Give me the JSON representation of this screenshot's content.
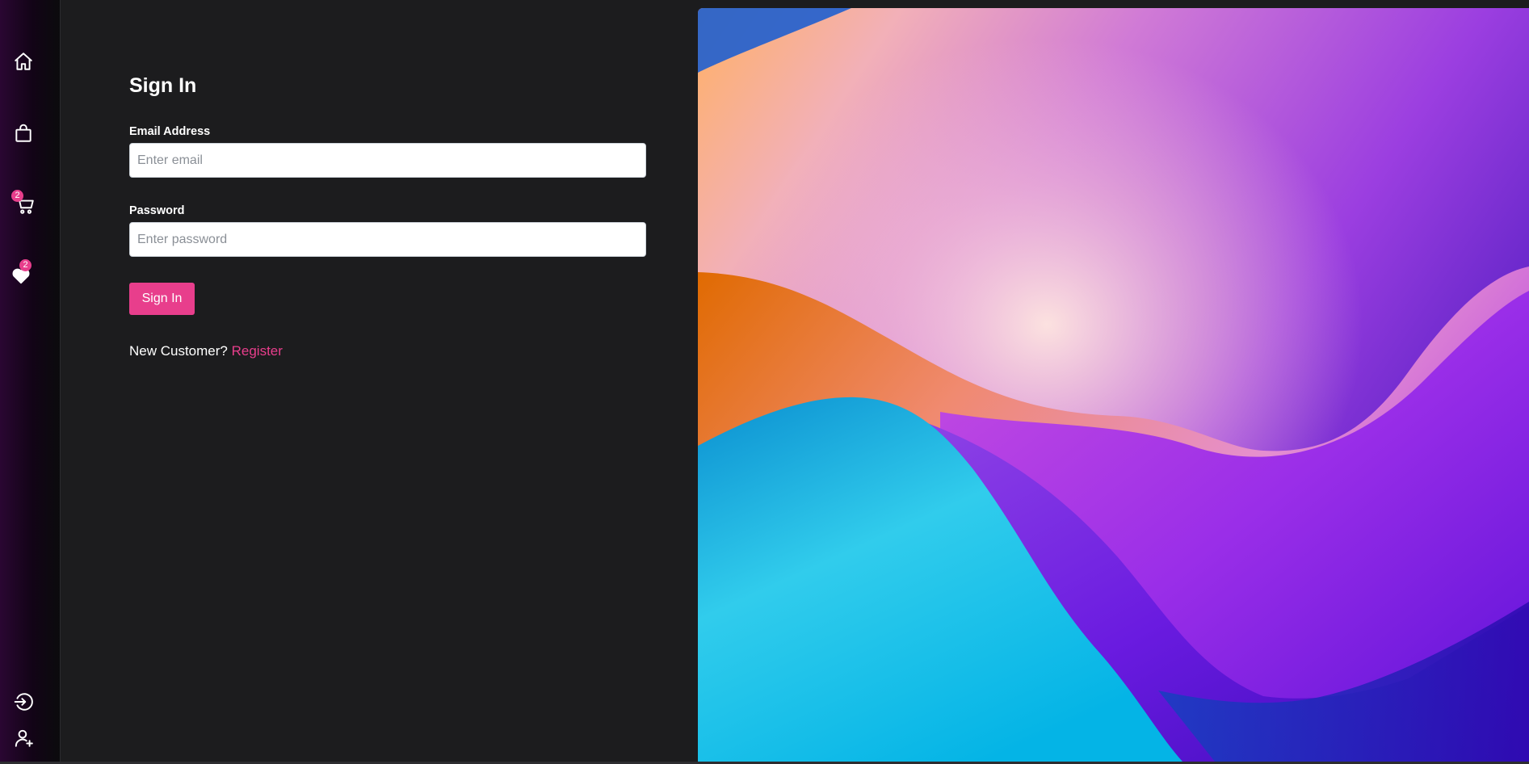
{
  "sidebar": {
    "items": [
      {
        "name": "home",
        "icon": "home-icon"
      },
      {
        "name": "shop",
        "icon": "shopping-bag-icon"
      },
      {
        "name": "cart",
        "icon": "cart-icon",
        "badge": "2"
      },
      {
        "name": "favorites",
        "icon": "heart-icon",
        "badge": "2"
      },
      {
        "name": "login",
        "icon": "login-icon"
      },
      {
        "name": "register",
        "icon": "user-plus-icon"
      }
    ]
  },
  "form": {
    "title": "Sign In",
    "email_label": "Email Address",
    "email_placeholder": "Enter email",
    "email_value": "",
    "password_label": "Password",
    "password_placeholder": "Enter password",
    "password_value": "",
    "submit_label": "Sign In",
    "register_prompt": "New Customer?",
    "register_link": "Register"
  },
  "colors": {
    "accent": "#e83e8c",
    "background": "#1c1c1e",
    "sidebar_gradient_start": "#2a0632"
  }
}
